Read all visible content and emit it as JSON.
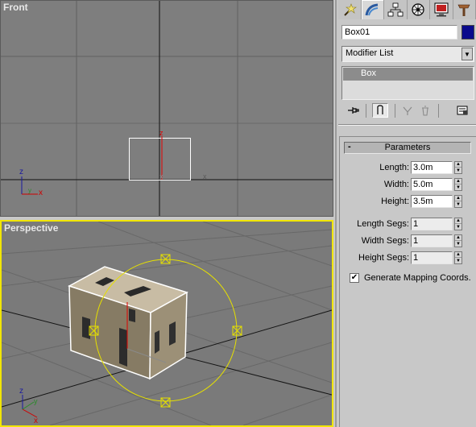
{
  "viewports": {
    "front": {
      "label": "Front"
    },
    "perspective": {
      "label": "Perspective"
    }
  },
  "axis_labels": {
    "x": "x",
    "y": "y",
    "z": "z"
  },
  "command_panel": {
    "tabs": [
      {
        "name": "create",
        "icon": "create-icon"
      },
      {
        "name": "modify",
        "icon": "modify-icon"
      },
      {
        "name": "hierarchy",
        "icon": "hierarchy-icon"
      },
      {
        "name": "motion",
        "icon": "motion-icon"
      },
      {
        "name": "display",
        "icon": "display-icon"
      },
      {
        "name": "utilities",
        "icon": "utilities-icon"
      }
    ],
    "object_name": "Box01",
    "object_color": "#0a0a8c",
    "modifier_list": "Modifier List",
    "stack_items": [
      "Box"
    ],
    "rollout": {
      "collapse_symbol": "-",
      "title": "Parameters",
      "params": [
        {
          "label": "Length:",
          "value": "3.0m"
        },
        {
          "label": "Width:",
          "value": "5.0m"
        },
        {
          "label": "Height:",
          "value": "3.5m"
        }
      ],
      "segs": [
        {
          "label": "Length Segs:",
          "value": "1"
        },
        {
          "label": "Width Segs:",
          "value": "1"
        },
        {
          "label": "Height Segs:",
          "value": "1"
        }
      ],
      "generate_mapping": {
        "label": "Generate Mapping Coords.",
        "checked": true,
        "check_mark": "✔"
      }
    }
  },
  "colors": {
    "viewport_bg": "#7e7e7e",
    "grid_line": "#5a5a5a",
    "active_viewport_border": "#f2e600",
    "selection_white": "#ffffff",
    "gizmo_yellow": "#e6e000"
  }
}
